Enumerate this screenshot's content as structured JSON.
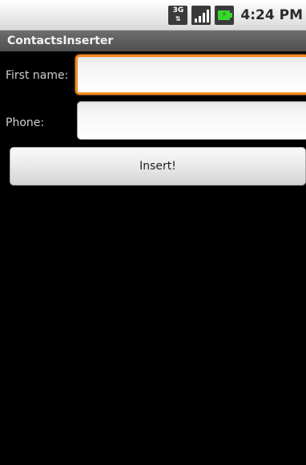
{
  "status_bar": {
    "network_icon": "3g-data-icon",
    "network_text": "3G",
    "signal_icon": "signal-strength-icon",
    "battery_icon": "battery-charging-icon",
    "time": "4:24 PM"
  },
  "app": {
    "title": "ContactsInserter"
  },
  "form": {
    "first_name_label": "First name:",
    "first_name_value": "",
    "phone_label": "Phone:",
    "phone_value": "",
    "insert_label": "Insert!"
  },
  "colors": {
    "focus_ring": "#f58a1f",
    "title_bar": "#5a5a5a",
    "background": "#000000"
  }
}
